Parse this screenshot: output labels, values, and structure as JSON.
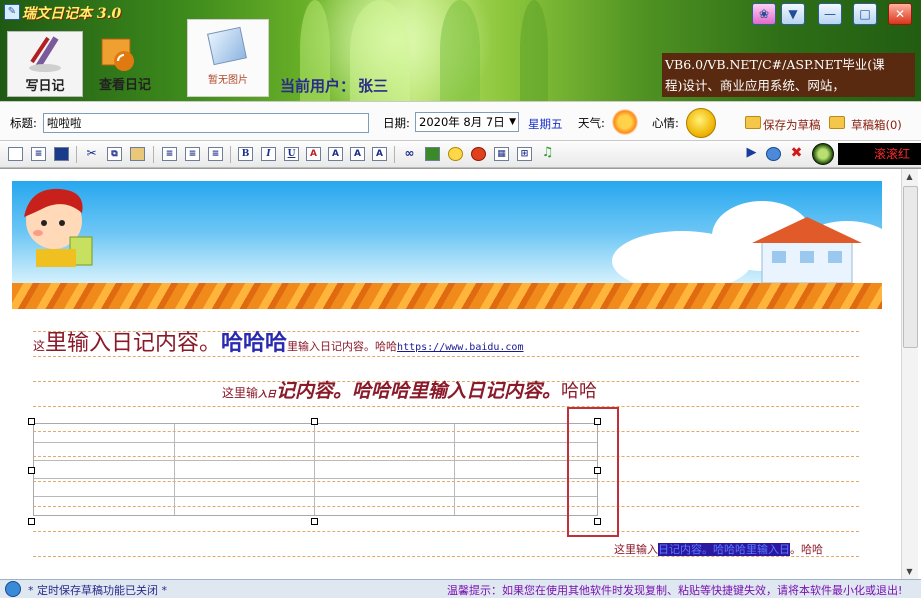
{
  "app": {
    "title": "瑞文日记本 3.0",
    "icon": "notebook-icon"
  },
  "window": {
    "minimize_label": "—",
    "restore_label": "□",
    "close_label": "✕"
  },
  "nav": {
    "write_label": "写日记",
    "view_label": "查看日记",
    "photo_label": "暂无图片"
  },
  "user": {
    "label": "当前用户：",
    "name": "张三"
  },
  "promo": {
    "line1": "VB6.0/VB.NET/C#/ASP.NET毕业(课",
    "line2": "程)设计、商业应用系统、网站，"
  },
  "entry": {
    "title_label": "标题:",
    "title_value": "啦啦啦",
    "date_label": "日期:",
    "date_value": "2020年 8月 7日",
    "weekday": "星期五",
    "weather_label": "天气:",
    "mood_label": "心情:",
    "save_draft_label": "保存为草稿",
    "draft_box_label": "草稿箱(0)"
  },
  "toolbar": {
    "marquee": "滚滚红"
  },
  "editor": {
    "l1_small": "这",
    "l1_big": "里输入日记内容。",
    "l1_blue": "哈哈哈",
    "l1_tail": "里输入日记内容。哈哈",
    "l1_link": "https://www.baidu.com",
    "l2_small": "这里输",
    "l2_tiny": "入日",
    "l2_big": "记内容。哈哈哈里输入日记内容。",
    "l2_tail": "哈哈",
    "l3_head": "这里输入",
    "l3_hl": "日记内容。哈哈哈里输入日",
    "l3_tail": "。哈哈"
  },
  "status": {
    "left": "* 定时保存草稿功能已关闭 *",
    "right": "温馨提示：如果您在使用其他软件时发现复制、粘贴等快捷键失效，请将本软件最小化或退出!"
  }
}
